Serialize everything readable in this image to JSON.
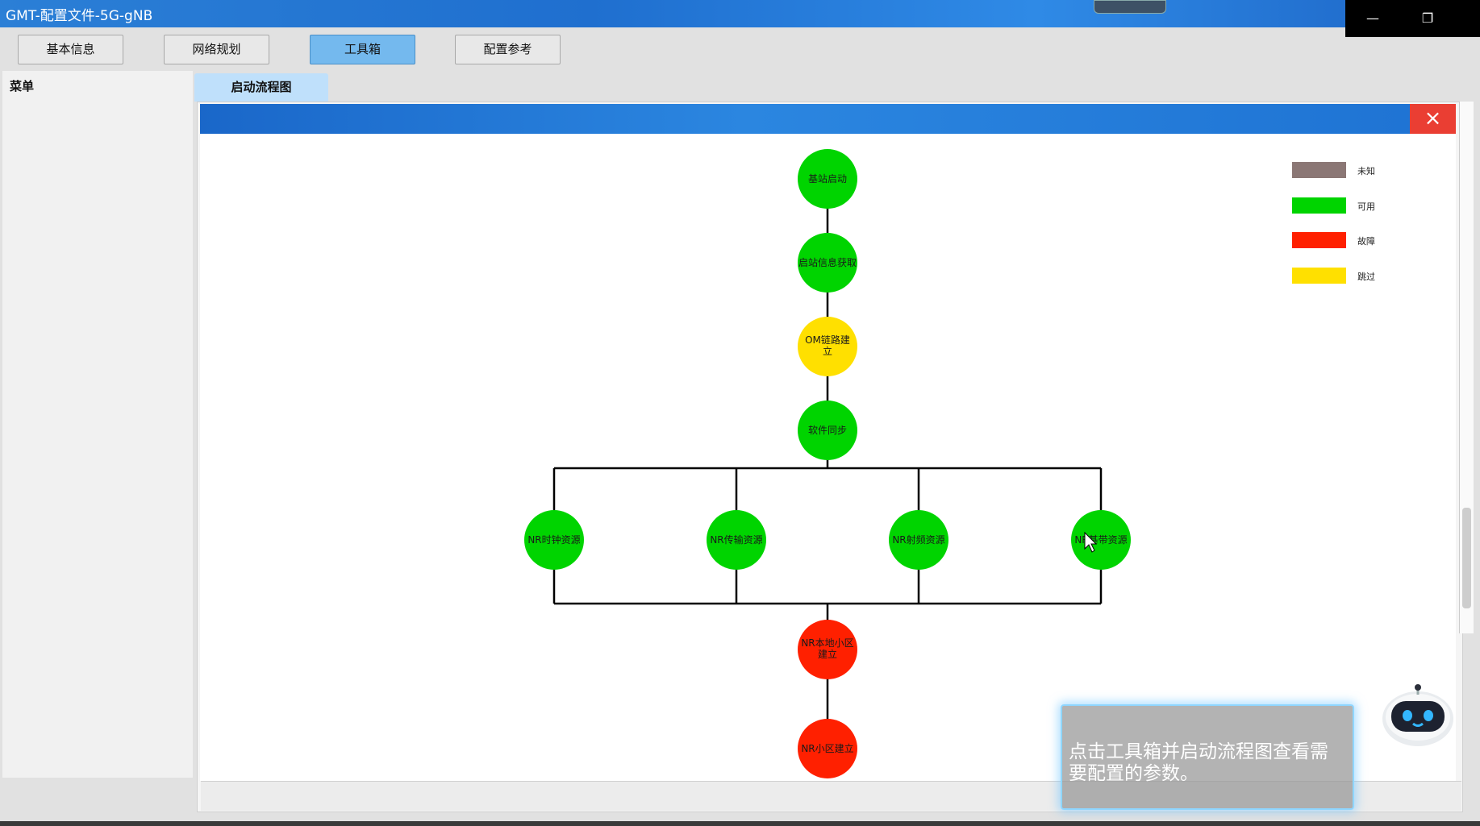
{
  "window": {
    "title": "GMT-配置文件-5G-gNB"
  },
  "window_controls": {
    "minimize": "—",
    "restore": "❐"
  },
  "toolbar": {
    "buttons": [
      {
        "label": "基本信息",
        "active": false
      },
      {
        "label": "网络规划",
        "active": false
      },
      {
        "label": "工具箱",
        "active": true
      },
      {
        "label": "配置参考",
        "active": false
      }
    ]
  },
  "sidebar": {
    "title": "菜单"
  },
  "tabs": [
    {
      "label": "启动流程图"
    }
  ],
  "modal": {
    "close_icon": "×"
  },
  "flowchart": {
    "nodes": [
      {
        "id": "n1",
        "label": "基站启动",
        "status": "available"
      },
      {
        "id": "n2",
        "label": "启站信息获取",
        "status": "available"
      },
      {
        "id": "n3",
        "label": "OM链路建立",
        "status": "skipped"
      },
      {
        "id": "n4",
        "label": "软件同步",
        "status": "available"
      },
      {
        "id": "n5a",
        "label": "NR时钟资源",
        "status": "available"
      },
      {
        "id": "n5b",
        "label": "NR传输资源",
        "status": "available"
      },
      {
        "id": "n5c",
        "label": "NR射频资源",
        "status": "available"
      },
      {
        "id": "n5d",
        "label": "NR基带资源",
        "status": "available"
      },
      {
        "id": "n6",
        "label": "NR本地小区建立",
        "status": "fault"
      },
      {
        "id": "n7",
        "label": "NR小区建立",
        "status": "fault"
      }
    ],
    "edges": [
      [
        "n1",
        "n2"
      ],
      [
        "n2",
        "n3"
      ],
      [
        "n3",
        "n4"
      ],
      [
        "n4",
        "n5a"
      ],
      [
        "n4",
        "n5b"
      ],
      [
        "n4",
        "n5c"
      ],
      [
        "n4",
        "n5d"
      ],
      [
        "n5a",
        "n6"
      ],
      [
        "n5b",
        "n6"
      ],
      [
        "n5c",
        "n6"
      ],
      [
        "n5d",
        "n6"
      ],
      [
        "n6",
        "n7"
      ]
    ]
  },
  "legend": [
    {
      "label": "未知",
      "color": "#8b7775",
      "status": "unknown"
    },
    {
      "label": "可用",
      "color": "#00d400",
      "status": "available"
    },
    {
      "label": "故障",
      "color": "#ff2000",
      "status": "fault"
    },
    {
      "label": "跳过",
      "color": "#ffe000",
      "status": "skipped"
    }
  ],
  "assistant": {
    "message": "点击工具箱并启动流程图查看需要配置的参数。"
  }
}
